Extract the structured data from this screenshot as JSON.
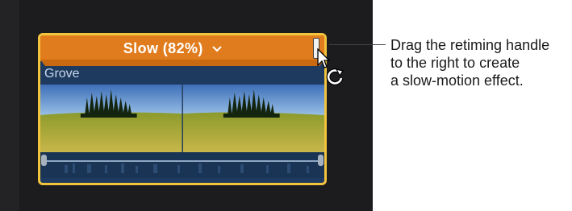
{
  "clip": {
    "retime_label": "Slow (82%)",
    "name": "Grove"
  },
  "callout": {
    "lines": [
      "Drag the retiming handle",
      "to the right to create",
      "a slow-motion effect."
    ]
  },
  "colors": {
    "timeline_bg": "#1c1c1e",
    "clip_border": "#f2c33d",
    "retime_bar": "#e07c1d",
    "clip_body": "#1e3a5e"
  },
  "icons": {
    "chevron": "chevron-down-icon",
    "pointer": "pointer-cursor-icon",
    "retime": "retime-cursor-icon"
  }
}
